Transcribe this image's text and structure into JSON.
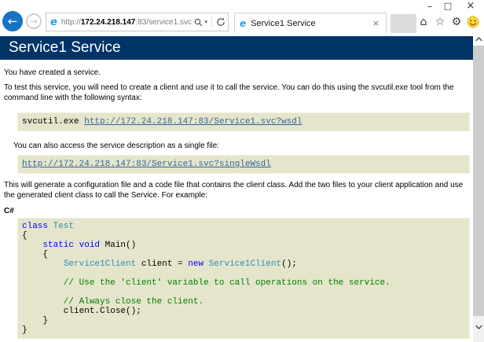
{
  "colors": {
    "header_bg": "#003366",
    "code_bg": "#e5e5cc",
    "link": "#336699",
    "keyword": "#0000ff",
    "type": "#2b91af",
    "comment": "#008000",
    "back_button": "#1673c5",
    "smiley": "#ffd83d"
  },
  "icons": {
    "back": "←",
    "forward": "→",
    "caret": "▾",
    "home": "⌂",
    "favorites": "☆",
    "settings": "⚙",
    "minimize": "–",
    "maximize": "□",
    "close": "×",
    "tab_close": "×",
    "search": "magnifier-svg",
    "refresh": "circular-arrow-svg",
    "feedback": "smiley-svg",
    "scroll_up": "chevron-up-svg",
    "scroll_down": "chevron-down-svg"
  },
  "browser": {
    "address": {
      "protocol": "http://",
      "host": "172.24.218.147",
      "path": ":83/service1.svc"
    },
    "tab": {
      "title": "Service1 Service"
    }
  },
  "page": {
    "heading": "Service1 Service",
    "intro": "You have created a service.",
    "test_paragraph": "To test this service, you will need to create a client and use it to call the service. You can do this using the svcutil.exe tool from the command line with the following syntax:",
    "svcutil_prefix": "svcutil.exe ",
    "wsdl_link": "http://172.24.218.147:83/Service1.svc?wsdl",
    "single_file_paragraph": "You can also access the service description as a single file:",
    "single_wsdl_link": "http://172.24.218.147:83/Service1.svc?singleWsdl",
    "generate_paragraph": "This will generate a configuration file and a code file that contains the client class. Add the two files to your client application and use the generated client class to call the Service. For example:",
    "language_label": "C#",
    "code": {
      "lines": [
        [
          {
            "s": "kw",
            "x": "class"
          },
          {
            "s": "pl",
            "x": " "
          },
          {
            "s": "ty",
            "x": "Test"
          }
        ],
        [
          {
            "s": "pl",
            "x": "{"
          }
        ],
        [
          {
            "s": "pl",
            "x": "    "
          },
          {
            "s": "kw",
            "x": "static"
          },
          {
            "s": "pl",
            "x": " "
          },
          {
            "s": "kw",
            "x": "void"
          },
          {
            "s": "pl",
            "x": " Main()"
          }
        ],
        [
          {
            "s": "pl",
            "x": "    {"
          }
        ],
        [
          {
            "s": "pl",
            "x": "        "
          },
          {
            "s": "ty",
            "x": "Service1Client"
          },
          {
            "s": "pl",
            "x": " client = "
          },
          {
            "s": "kw",
            "x": "new"
          },
          {
            "s": "pl",
            "x": " "
          },
          {
            "s": "ty",
            "x": "Service1Client"
          },
          {
            "s": "pl",
            "x": "();"
          }
        ],
        [],
        [
          {
            "s": "cm",
            "x": "        // Use the 'client' variable to call operations on the service."
          }
        ],
        [],
        [
          {
            "s": "cm",
            "x": "        // Always close the client."
          }
        ],
        [
          {
            "s": "pl",
            "x": "        client.Close();"
          }
        ],
        [
          {
            "s": "pl",
            "x": "    }"
          }
        ],
        [
          {
            "s": "pl",
            "x": "}"
          }
        ]
      ]
    }
  }
}
